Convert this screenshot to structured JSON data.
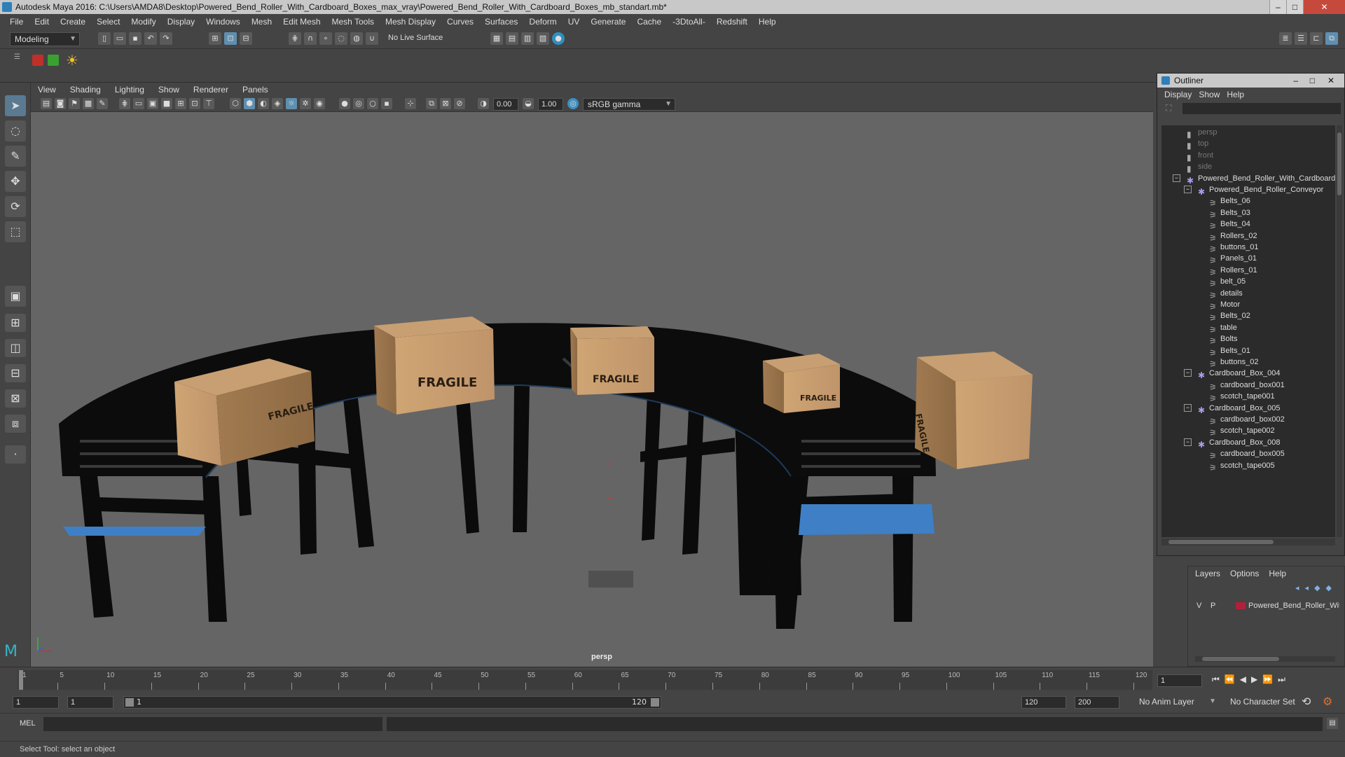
{
  "window": {
    "title": "Autodesk Maya 2016: C:\\Users\\AMDA8\\Desktop\\Powered_Bend_Roller_With_Cardboard_Boxes_max_vray\\Powered_Bend_Roller_With_Cardboard_Boxes_mb_standart.mb*"
  },
  "menubar": [
    "File",
    "Edit",
    "Create",
    "Select",
    "Modify",
    "Display",
    "Windows",
    "Mesh",
    "Edit Mesh",
    "Mesh Tools",
    "Mesh Display",
    "Curves",
    "Surfaces",
    "Deform",
    "UV",
    "Generate",
    "Cache",
    "-3DtoAll-",
    "Redshift",
    "Help"
  ],
  "toolbar": {
    "mode": "Modeling",
    "live_surface": "No Live Surface"
  },
  "panel": {
    "menu": [
      "View",
      "Shading",
      "Lighting",
      "Show",
      "Renderer",
      "Panels"
    ],
    "exposure": "0.00",
    "gamma": "1.00",
    "colorspace": "sRGB gamma",
    "camera_label": "persp"
  },
  "viewport": {
    "box_label": "FRAGILE"
  },
  "outliner": {
    "title": "Outliner",
    "menu": [
      "Display",
      "Show",
      "Help"
    ],
    "items": [
      {
        "label": "persp",
        "type": "camera",
        "depth": 0
      },
      {
        "label": "top",
        "type": "camera",
        "depth": 0
      },
      {
        "label": "front",
        "type": "camera",
        "depth": 0
      },
      {
        "label": "side",
        "type": "camera",
        "depth": 0
      },
      {
        "label": "Powered_Bend_Roller_With_Cardboard_Boxes",
        "type": "group",
        "depth": 0
      },
      {
        "label": "Powered_Bend_Roller_Conveyor",
        "type": "group",
        "depth": 1
      },
      {
        "label": "Belts_06",
        "type": "mesh",
        "depth": 2
      },
      {
        "label": "Belts_03",
        "type": "mesh",
        "depth": 2
      },
      {
        "label": "Belts_04",
        "type": "mesh",
        "depth": 2
      },
      {
        "label": "Rollers_02",
        "type": "mesh",
        "depth": 2
      },
      {
        "label": "buttons_01",
        "type": "mesh",
        "depth": 2
      },
      {
        "label": "Panels_01",
        "type": "mesh",
        "depth": 2
      },
      {
        "label": "Rollers_01",
        "type": "mesh",
        "depth": 2
      },
      {
        "label": "belt_05",
        "type": "mesh",
        "depth": 2
      },
      {
        "label": "details",
        "type": "mesh",
        "depth": 2
      },
      {
        "label": "Motor",
        "type": "mesh",
        "depth": 2
      },
      {
        "label": "Belts_02",
        "type": "mesh",
        "depth": 2
      },
      {
        "label": "table",
        "type": "mesh",
        "depth": 2
      },
      {
        "label": "Bolts",
        "type": "mesh",
        "depth": 2
      },
      {
        "label": "Belts_01",
        "type": "mesh",
        "depth": 2
      },
      {
        "label": "buttons_02",
        "type": "mesh",
        "depth": 2
      },
      {
        "label": "Cardboard_Box_004",
        "type": "group",
        "depth": 1
      },
      {
        "label": "cardboard_box001",
        "type": "mesh",
        "depth": 2
      },
      {
        "label": "scotch_tape001",
        "type": "mesh",
        "depth": 2
      },
      {
        "label": "Cardboard_Box_005",
        "type": "group",
        "depth": 1
      },
      {
        "label": "cardboard_box002",
        "type": "mesh",
        "depth": 2
      },
      {
        "label": "scotch_tape002",
        "type": "mesh",
        "depth": 2
      },
      {
        "label": "Cardboard_Box_008",
        "type": "group",
        "depth": 1
      },
      {
        "label": "cardboard_box005",
        "type": "mesh",
        "depth": 2
      },
      {
        "label": "scotch_tape005",
        "type": "mesh",
        "depth": 2
      }
    ]
  },
  "layers": {
    "menu": [
      "Layers",
      "Options",
      "Help"
    ],
    "row": {
      "v": "V",
      "p": "P",
      "name": "Powered_Bend_Roller_With_Cardboard_Boxes",
      "color": "#b0203a"
    }
  },
  "timeline": {
    "ticks": [
      "1",
      "5",
      "10",
      "15",
      "20",
      "25",
      "30",
      "35",
      "40",
      "45",
      "50",
      "55",
      "60",
      "65",
      "70",
      "75",
      "80",
      "85",
      "90",
      "95",
      "100",
      "105",
      "110",
      "115",
      "120"
    ],
    "current_frame": "1"
  },
  "range": {
    "start": "1",
    "start2": "1",
    "slider_start": "1",
    "slider_end": "120",
    "end": "120",
    "end2": "200",
    "anim_layer": "No Anim Layer",
    "char_set": "No Character Set"
  },
  "cmdline": {
    "label": "MEL"
  },
  "helpline": {
    "text": "Select Tool: select an object"
  },
  "colors": {
    "belt_blue": "#3f7fc6",
    "cardboard": "#c49a6c",
    "frame": "#0c0c0c"
  }
}
